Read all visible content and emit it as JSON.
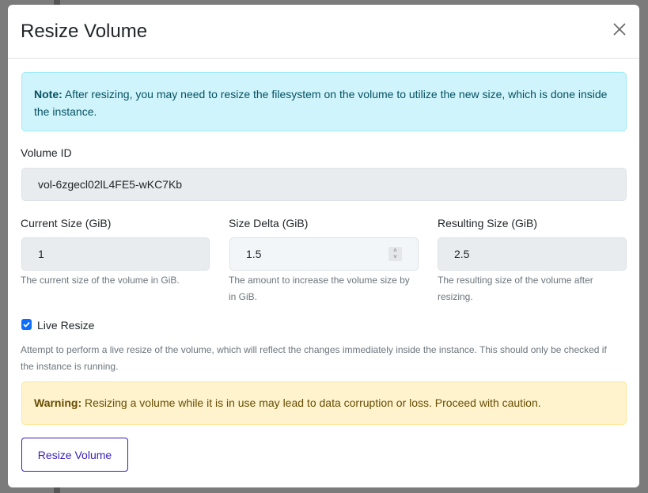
{
  "modal": {
    "title": "Resize Volume"
  },
  "note": {
    "label": "Note:",
    "text": " After resizing, you may need to resize the filesystem on the volume to utilize the new size, which is done inside the instance."
  },
  "volume_id": {
    "label": "Volume ID",
    "value": "vol-6zgecl02lL4FE5-wKC7Kb"
  },
  "current_size": {
    "label": "Current Size (GiB)",
    "value": "1",
    "help": "The current size of the volume in GiB."
  },
  "size_delta": {
    "label": "Size Delta (GiB)",
    "value": "1.5",
    "help": "The amount to increase the volume size by in GiB."
  },
  "resulting_size": {
    "label": "Resulting Size (GiB)",
    "value": "2.5",
    "help": "The resulting size of the volume after resizing."
  },
  "live_resize": {
    "label": "Live Resize",
    "checked": true,
    "help": "Attempt to perform a live resize of the volume, which will reflect the changes immediately inside the instance. This should only be checked if the instance is running."
  },
  "warning": {
    "label": "Warning:",
    "text": " Resizing a volume while it is in use may lead to data corruption or loss. Proceed with caution."
  },
  "submit_label": "Resize Volume"
}
